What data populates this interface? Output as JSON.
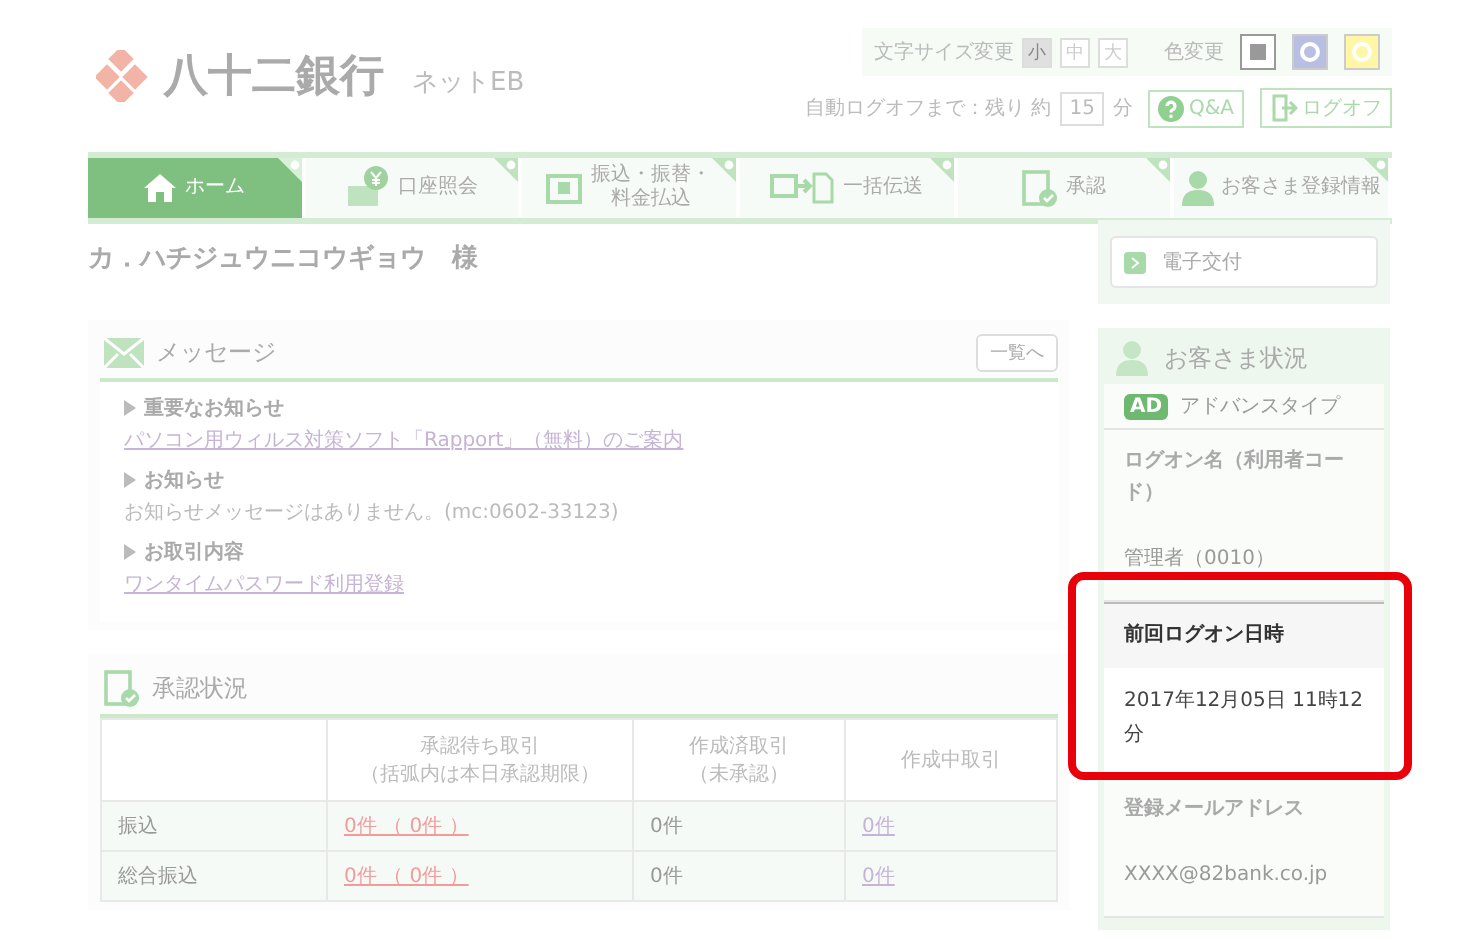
{
  "header": {
    "bank_name": "八十二銀行",
    "service_name": "ネットEB",
    "font_size": {
      "label": "文字サイズ変更",
      "options": [
        {
          "label": "小",
          "selected": true
        },
        {
          "label": "中",
          "selected": false
        },
        {
          "label": "大",
          "selected": false
        }
      ]
    },
    "color_change": {
      "label": "色変更",
      "options": [
        {
          "kind": "square",
          "color": "#ffffff",
          "selected": true
        },
        {
          "kind": "circle",
          "color": "#b9bfe2",
          "selected": false
        },
        {
          "kind": "circle",
          "color": "#fff6a6",
          "selected": false
        }
      ]
    },
    "auto_logoff": {
      "label": "自動ログオフまで：残り 約",
      "minutes": "15",
      "unit": "分"
    },
    "help_button": "Q&A",
    "logoff_button": "ログオフ"
  },
  "nav": [
    {
      "kind": "home",
      "label": "ホーム",
      "selected": true
    },
    {
      "kind": "account",
      "label": "口座照会",
      "selected": false
    },
    {
      "kind": "transfer",
      "label": "振込・振替・料金払込",
      "selected": false
    },
    {
      "kind": "batch",
      "label": "一括伝送",
      "selected": false
    },
    {
      "kind": "approve",
      "label": "承認",
      "selected": false
    },
    {
      "kind": "user",
      "label": "お客さま登録情報",
      "selected": false
    }
  ],
  "customer_name": "カ．ハチジュウニコウギョウ　様",
  "messages": {
    "title": "メッセージ",
    "list_button": "一覧へ",
    "sections": [
      {
        "heading": "重要なお知らせ",
        "kind": "link",
        "text": "パソコン用ウィルス対策ソフト「Rapport」（無料）のご案内"
      },
      {
        "heading": "お知らせ",
        "kind": "plain",
        "text": "お知らせメッセージはありません。(mc:0602-33123)"
      },
      {
        "heading": "お取引内容",
        "kind": "link",
        "text": "ワンタイムパスワード利用登録"
      }
    ]
  },
  "approval": {
    "title": "承認状況",
    "columns": [
      {},
      {
        "title": "承認待ち取引",
        "note": "（括弧内は本日承認期限）"
      },
      {
        "title": "作成済取引",
        "note": "（未承認）"
      },
      {
        "title": "作成中取引"
      }
    ],
    "rows": [
      {
        "cells": [
          {
            "kind": "label",
            "text": "振込"
          },
          {
            "kind": "alert",
            "text": "0件 （ 0件 ）"
          },
          {
            "kind": "plain",
            "text": "0件"
          },
          {
            "kind": "link",
            "text": "0件"
          }
        ]
      },
      {
        "cells": [
          {
            "kind": "label",
            "text": "総合振込"
          },
          {
            "kind": "alert",
            "text": "0件 （ 0件 ）"
          },
          {
            "kind": "plain",
            "text": "0件"
          },
          {
            "kind": "link",
            "text": "0件"
          }
        ]
      }
    ]
  },
  "sidebar": {
    "e_delivery_button": "電子交付",
    "status": {
      "title": "お客さま状況",
      "plan_badge": "AD",
      "plan": "アドバンスタイプ",
      "fields": [
        {
          "label": "ログオン名（利用者コード）",
          "value": "管理者（0010）",
          "highlighted": false
        },
        {
          "label": "前回ログオン日時",
          "value": "2017年12月05日 11時12分",
          "highlighted": true
        },
        {
          "label": "登録メールアドレス",
          "value": "XXXX@82bank.co.jp",
          "highlighted": false
        }
      ]
    }
  }
}
